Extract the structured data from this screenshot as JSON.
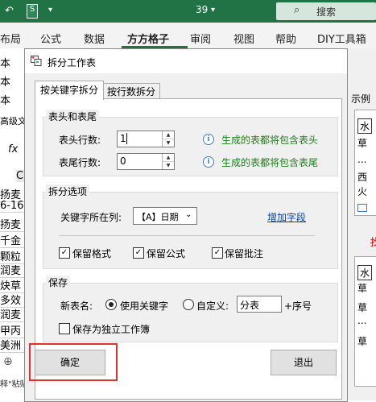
{
  "excel": {
    "title_number": "39",
    "search_placeholder": "搜索",
    "ribbon_tabs": [
      "布局",
      "公式",
      "数据",
      "方方格子",
      "审阅",
      "视图",
      "帮助",
      "DIY工具箱"
    ],
    "left_cells": [
      "本",
      "本",
      "本",
      "高级文",
      "fx",
      "C",
      "扬麦",
      "6-16",
      "扬麦",
      "千金",
      "颗粒",
      "润麦",
      "炔草",
      "多效",
      "润麦",
      "甲丙",
      "美洲",
      "⊕",
      "释\"粘贴"
    ],
    "right_labels": [
      "示例",
      "水",
      "草",
      "...",
      "西",
      "火",
      "找",
      "水",
      "草",
      "草",
      "...",
      "草"
    ]
  },
  "dialog": {
    "title": "拆分工作表",
    "tabs": [
      "按关键字拆分",
      "按行数拆分"
    ],
    "header_footer": {
      "group_title": "表头和表尾",
      "header_rows_label": "表头行数:",
      "header_rows_value": "1",
      "footer_rows_label": "表尾行数:",
      "footer_rows_value": "0",
      "header_hint": "生成的表都将包含表头",
      "footer_hint": "生成的表都将包含表尾"
    },
    "split_options": {
      "group_title": "拆分选项",
      "keyword_col_label": "关键字所在列:",
      "keyword_col_value": "【A】日期",
      "add_field_link": "增加字段",
      "keep_format": "保留格式",
      "keep_formula": "保留公式",
      "keep_comment": "保留批注"
    },
    "save": {
      "group_title": "保存",
      "new_table_name_label": "新表名:",
      "use_keyword": "使用关键字",
      "custom": "自定义:",
      "custom_value": "分表",
      "seq_suffix": "+序号",
      "save_as_workbook": "保存为独立工作簿"
    },
    "ok_button": "确定",
    "exit_button": "退出"
  },
  "colors": {
    "excel_green": "#217346",
    "highlight_red": "#e03030",
    "hint_green": "#1e7d1e",
    "link_blue": "#0645ad"
  }
}
